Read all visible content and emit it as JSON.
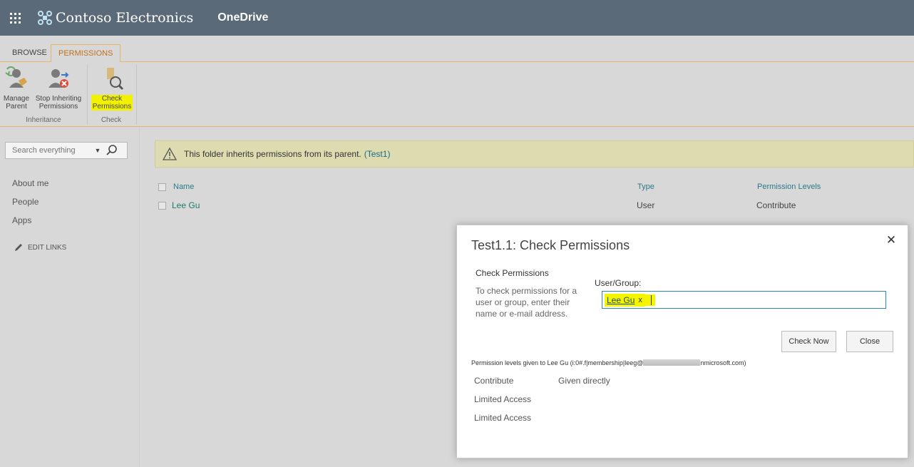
{
  "suite": {
    "brand": "Contoso Electronics",
    "app": "OneDrive",
    "icons": {
      "launcher": "app-launcher-icon",
      "logo": "contoso-logo-icon"
    }
  },
  "ribbon": {
    "tabs": [
      {
        "label": "BROWSE",
        "active": false
      },
      {
        "label": "PERMISSIONS",
        "active": true
      }
    ],
    "buttons": [
      {
        "line1": "Manage",
        "line2": "Parent",
        "icon": "manage-parent-icon"
      },
      {
        "line1": "Stop Inheriting",
        "line2": "Permissions",
        "icon": "stop-inheriting-icon"
      },
      {
        "line1": "Check",
        "line2": "Permissions",
        "icon": "check-permissions-icon"
      }
    ],
    "groups": {
      "inheritance": "Inheritance",
      "check": "Check"
    }
  },
  "leftnav": {
    "search_placeholder": "Search everything",
    "links": [
      "About me",
      "People",
      "Apps"
    ],
    "edit_links": "EDIT LINKS"
  },
  "banner": {
    "text": "This folder inherits permissions from its parent.",
    "link": "(Test1)",
    "icon": "warning-icon"
  },
  "table": {
    "headers": {
      "name": "Name",
      "type": "Type",
      "levels": "Permission Levels"
    },
    "rows": [
      {
        "name": "Lee Gu",
        "type": "User",
        "levels": "Contribute"
      }
    ]
  },
  "dialog": {
    "title": "Test1.1: Check Permissions",
    "section_title": "Check Permissions",
    "description": "To check permissions for a user or group, enter their name or e-mail address.",
    "field_label": "User/Group:",
    "user_token": "Lee Gu",
    "token_remove": "x",
    "check_now": "Check Now",
    "close": "Close",
    "result_prefix": "Permission levels given to Lee Gu (i:0#.f|membership|leeg@",
    "result_suffix": "nmicrosoft.com)",
    "results": [
      {
        "level": "Contribute",
        "how": "Given directly"
      },
      {
        "level": "Limited Access",
        "how": ""
      },
      {
        "level": "Limited Access",
        "how": ""
      }
    ]
  },
  "colors": {
    "suitebar": "#5b6a78",
    "ribbon_accent": "#e6b466",
    "banner": "#dddbb0",
    "highlight": "#f2f200",
    "link": "#1a7a6e"
  }
}
